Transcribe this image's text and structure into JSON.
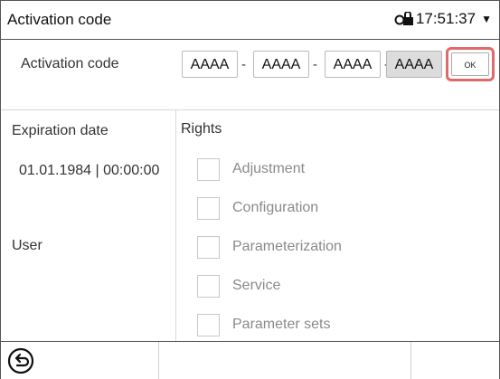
{
  "header": {
    "title": "Activation code",
    "time": "17:51:37",
    "lock_icon": "lock-icon",
    "dropdown_icon": "dropdown-arrow-icon"
  },
  "activation": {
    "label": "Activation code",
    "segments": [
      "AAAA",
      "AAAA",
      "AAAA",
      "AAAA"
    ],
    "separator": "-",
    "ok_label": "OK",
    "highlight_color": "#e06a6a"
  },
  "expiration": {
    "label": "Expiration date",
    "value": "01.01.1984 | 00:00:00"
  },
  "user": {
    "label": "User"
  },
  "rights": {
    "title": "Rights",
    "items": [
      {
        "label": "Adjustment",
        "checked": false
      },
      {
        "label": "Configuration",
        "checked": false
      },
      {
        "label": "Parameterization",
        "checked": false
      },
      {
        "label": "Service",
        "checked": false
      },
      {
        "label": "Parameter sets",
        "checked": false
      }
    ]
  },
  "footer": {
    "back_icon": "back-arrow-icon"
  }
}
